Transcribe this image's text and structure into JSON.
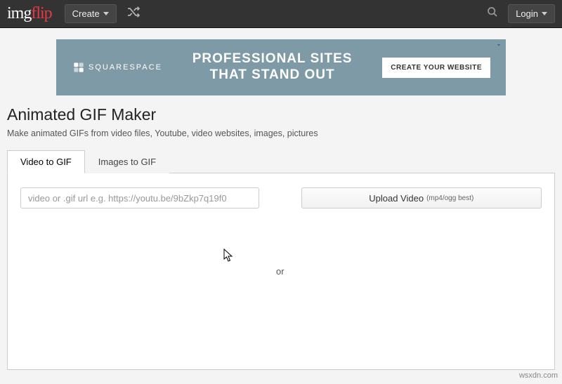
{
  "nav": {
    "logo_left": "img",
    "logo_right": "flip",
    "create_label": "Create",
    "login_label": "Login"
  },
  "ad": {
    "brand": "SQUARESPACE",
    "headline_l1": "PROFESSIONAL SITES",
    "headline_l2": "THAT STAND OUT",
    "cta": "CREATE YOUR WEBSITE"
  },
  "page": {
    "title": "Animated GIF Maker",
    "subtitle": "Make animated GIFs from video files, Youtube, video websites, images, pictures"
  },
  "tabs": {
    "video": "Video to GIF",
    "images": "Images to GIF"
  },
  "form": {
    "url_placeholder": "video or .gif url e.g. https://youtu.be/9bZkp7q19f0",
    "or": "or",
    "upload_label": "Upload Video",
    "upload_hint": "(mp4/ogg best)"
  },
  "watermark": "wsxdn.com"
}
